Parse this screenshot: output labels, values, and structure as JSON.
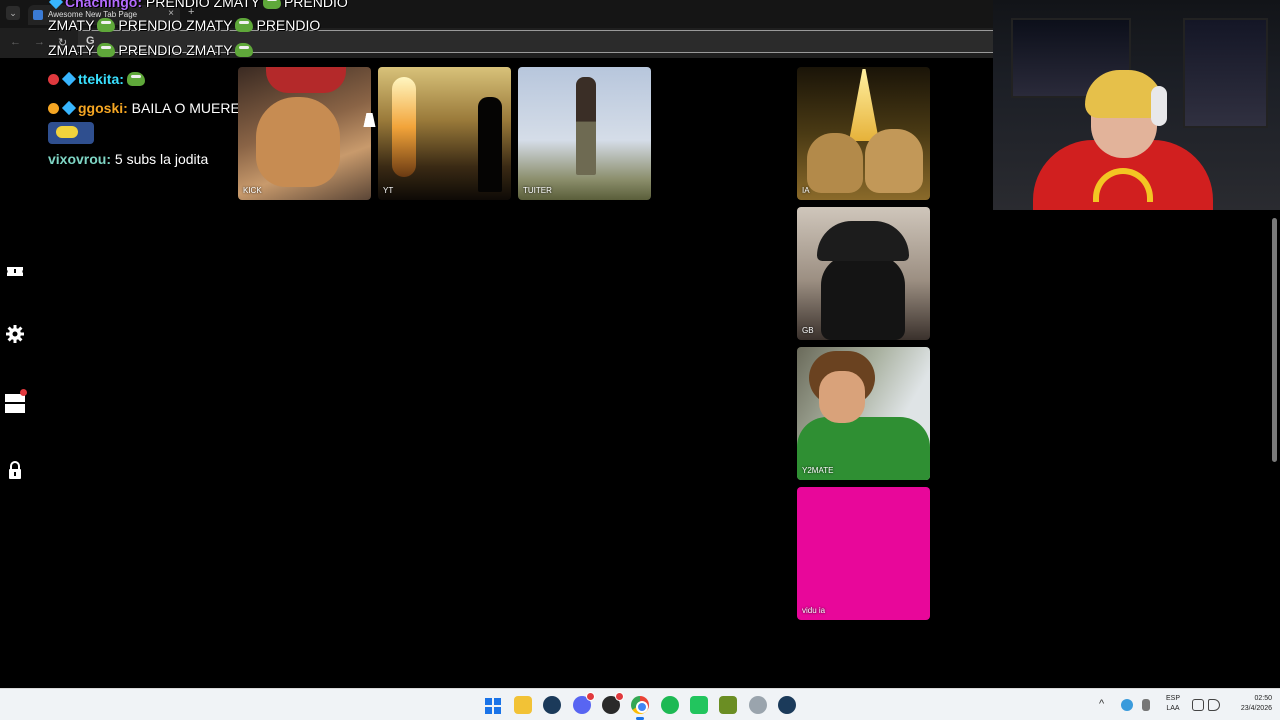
{
  "browser": {
    "tab_title": "Awesome New Tab Page",
    "tab_close": "×",
    "new_tab": "+",
    "tab_list": "⌄",
    "back": "←",
    "forward": "→",
    "reload": "↻",
    "omnibox_letter": "G"
  },
  "chat": {
    "line1": {
      "user": "Chachingo:",
      "user_color": "#b46bff",
      "message": "PRENDIO ZMATY",
      "tail": "PRENDIO"
    },
    "line2": {
      "message": "ZMATY",
      "mid": "PRENDIO ZMATY",
      "tail": "PRENDIO"
    },
    "line3": {
      "message": "ZMATY",
      "tail": "PRENDIO ZMATY"
    },
    "line4": {
      "user": "ttekita:",
      "user_color": "#39e0ff"
    },
    "line5": {
      "user": "ggoski:",
      "user_color": "#f5a623",
      "message": "BAILA O MUERE ES MUCHO"
    },
    "line6": {
      "user": "vixovrou:",
      "user_color": "#7fd6c5",
      "message": "5 subs la jodita"
    }
  },
  "rail": {
    "icons": [
      "ticket-icon",
      "gear-icon",
      "stack-icon",
      "lock-icon"
    ]
  },
  "tiles": [
    {
      "label": "KICK"
    },
    {
      "label": "YT"
    },
    {
      "label": "TUITER"
    },
    {
      "label": "IA"
    },
    {
      "label": "GB"
    },
    {
      "label": "Y2MATE"
    },
    {
      "label": "vidu ia",
      "color": "#e8079a"
    }
  ],
  "taskbar": {
    "language_top": "ESP",
    "language_bottom": "LAA",
    "time": "02:50",
    "date": "23/4/2026",
    "tray_caret": "^"
  }
}
